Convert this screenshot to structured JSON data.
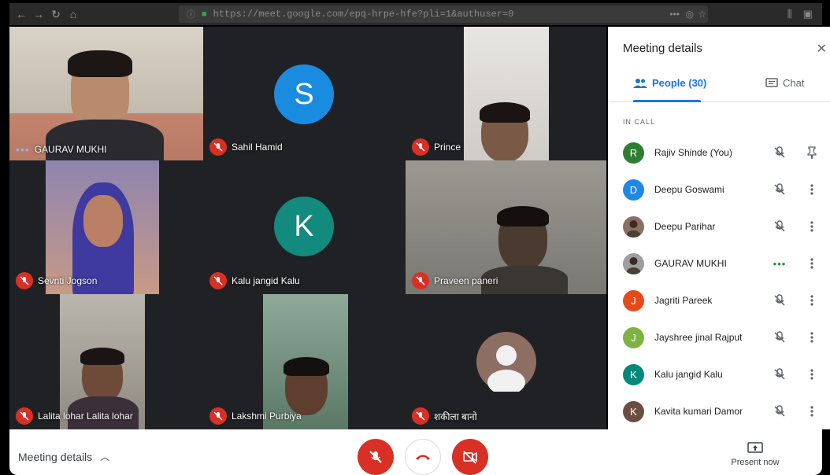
{
  "browser": {
    "url": "https://meet.google.com/epq-hrpe-hfe?pli=1&authuser=0",
    "back": "←",
    "forward": "→",
    "reload": "↻",
    "home": "⌂"
  },
  "tiles": [
    {
      "name": "GAURAV MUKHI",
      "type": "photo",
      "status": "speaking-dots",
      "bg": "#b8b0a8"
    },
    {
      "name": "Sahil Hamid",
      "type": "avatar",
      "initial": "S",
      "color": "#1a8ce0"
    },
    {
      "name": "Prince",
      "type": "photo",
      "bg": "#c7c3be"
    },
    {
      "name": "Sevnti Jogson",
      "type": "photo",
      "bg": "#5a4f8e"
    },
    {
      "name": "Kalu jangid Kalu",
      "type": "avatar",
      "initial": "K",
      "color": "#138a7e"
    },
    {
      "name": "Praveen paneri",
      "type": "photo",
      "bg": "#8a8882"
    },
    {
      "name": "Lalita lohar Lalita lohar",
      "type": "photo",
      "bg": "#a6a39c"
    },
    {
      "name": "Lakshmi Purbiya",
      "type": "photo",
      "bg": "#6c8f7c"
    },
    {
      "name": "शकीला बानो",
      "type": "generic",
      "color": "#8d6e63"
    }
  ],
  "panel": {
    "title": "Meeting details",
    "close_icon": "✕",
    "tab_people": "People (30)",
    "tab_chat": "Chat",
    "section": "IN CALL",
    "people": [
      {
        "name": "Rajiv Shinde (You)",
        "initial": "R",
        "color": "#2e7d32",
        "mic": "off",
        "action": "pin"
      },
      {
        "name": "Deepu Goswami",
        "initial": "D",
        "color": "#1e88e5",
        "mic": "off",
        "action": "more"
      },
      {
        "name": "Deepu Parihar",
        "initial": "",
        "color": "#8d6e63",
        "mic": "off",
        "action": "more"
      },
      {
        "name": "GAURAV MUKHI",
        "initial": "",
        "color": "#9e9e9e",
        "mic": "speaking",
        "action": "more"
      },
      {
        "name": "Jagriti Pareek",
        "initial": "J",
        "color": "#e64a19",
        "mic": "off",
        "action": "more"
      },
      {
        "name": "Jayshree jinal Rajput",
        "initial": "J",
        "color": "#7cb342",
        "mic": "off",
        "action": "more"
      },
      {
        "name": "Kalu jangid Kalu",
        "initial": "K",
        "color": "#00897b",
        "mic": "off",
        "action": "more"
      },
      {
        "name": "Kavita kumari Damor",
        "initial": "K",
        "color": "#6d4c41",
        "mic": "off",
        "action": "more"
      }
    ]
  },
  "bottom": {
    "meeting_details": "Meeting details",
    "present_now": "Present now"
  }
}
